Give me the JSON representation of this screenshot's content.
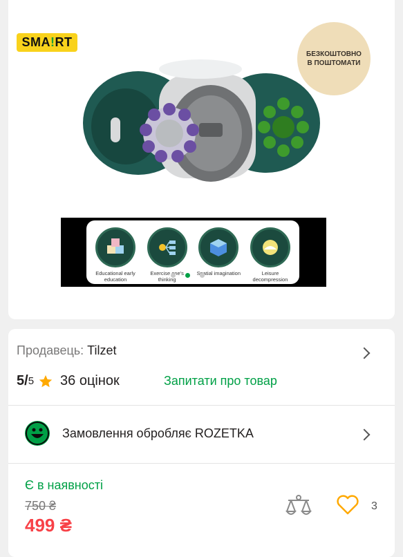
{
  "logo": {
    "before": "SMA",
    "mark": "!",
    "after": "RT"
  },
  "promo_badge": {
    "line1": "БЕЗКОШТОВНО",
    "line2": "В ПОШТОМАТИ"
  },
  "features": [
    {
      "label": "Educational early education"
    },
    {
      "label": "Exercise one's thinking"
    },
    {
      "label": "Spatial imagination"
    },
    {
      "label": "Leisure decompression"
    }
  ],
  "seller": {
    "label": "Продавець:",
    "name": "Tilzet"
  },
  "rating": {
    "score": "5/",
    "max": "5",
    "count": "36 оцінок"
  },
  "ask_link": "Запитати про товар",
  "order_handler": "Замовлення обробляє ROZETKA",
  "availability": "Є в наявності",
  "price": {
    "old": "750 ₴",
    "current": "499 ₴"
  },
  "wishlist_count": "3",
  "colors": {
    "accent": "#00a046",
    "price": "#f84147",
    "star": "#ffa900"
  }
}
